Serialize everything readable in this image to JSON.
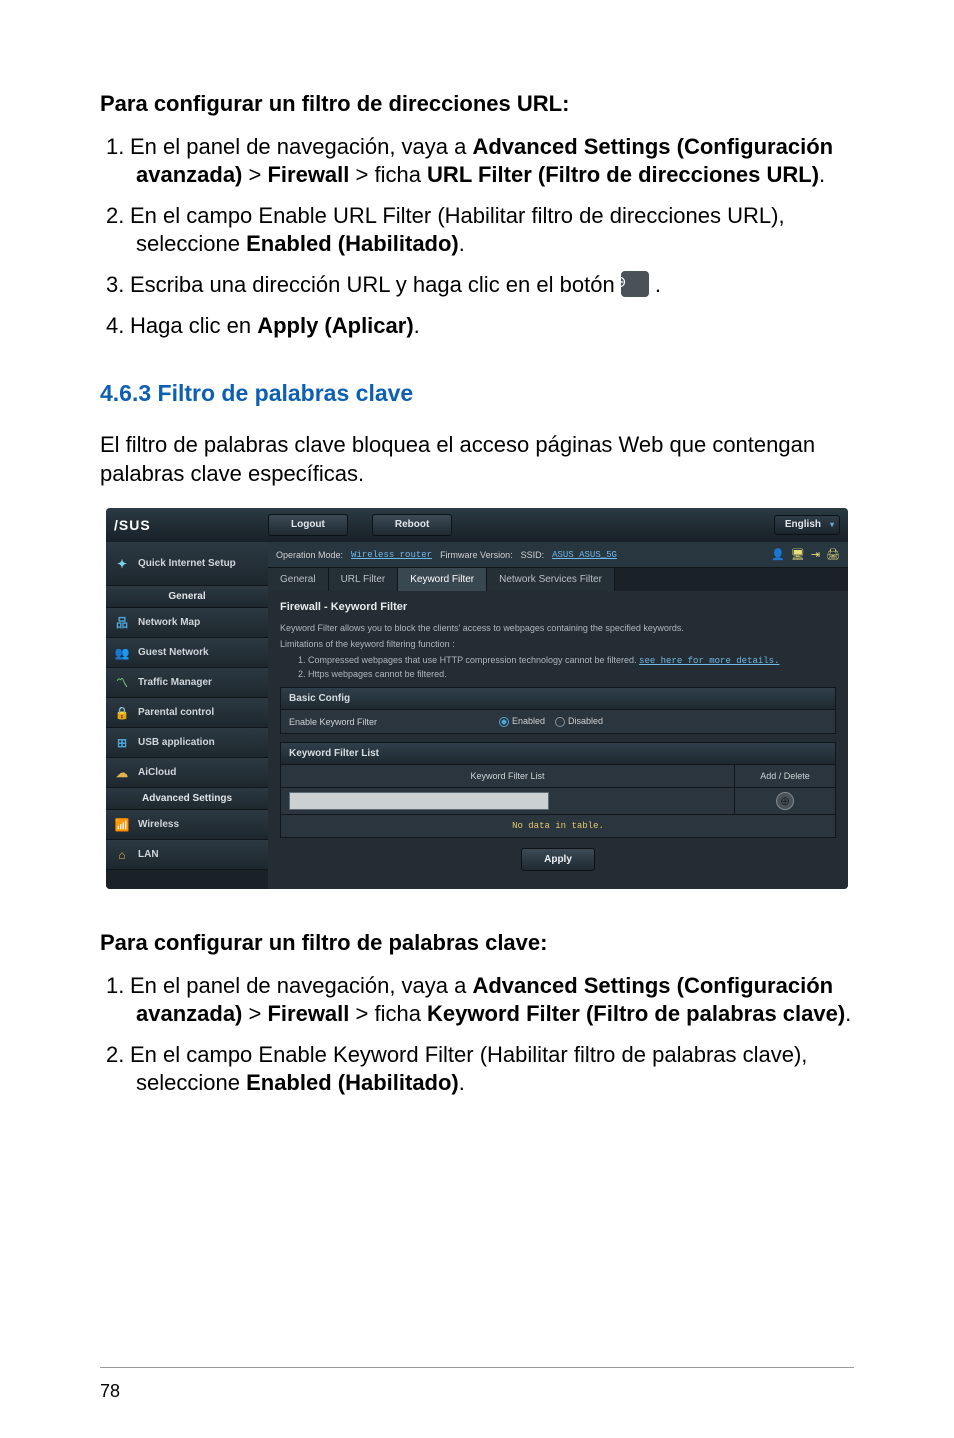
{
  "doc": {
    "section1_heading": "Para configurar un filtro de direcciones URL:",
    "section1_items": [
      "En el panel de navegación, vaya a <b>Advanced Settings (Configuración avanzada)</b> > <b>Firewall</b> > ficha <b>URL Filter (Filtro de direcciones URL)</b>.",
      "En el campo Enable URL Filter (Habilitar filtro de direcciones URL), seleccione <b>Enabled (Habilitado)</b>.",
      "Escriba una dirección URL y haga clic en el botón {ICON} .",
      "Haga clic en <b>Apply (Aplicar)</b>."
    ],
    "subsection_heading": "4.6.3  Filtro de palabras clave",
    "subsection_para": "El filtro de palabras clave bloquea el acceso páginas Web que contengan palabras clave específicas.",
    "section2_heading": "Para configurar un filtro de palabras clave:",
    "section2_items": [
      "En el panel de navegación, vaya a <b>Advanced Settings (Configuración avanzada)</b> > <b>Firewall</b> > ficha <b>Keyword Filter (Filtro de palabras clave)</b>.",
      "En el campo Enable Keyword Filter (Habilitar filtro de palabras clave), seleccione <b>Enabled (Habilitado)</b>."
    ],
    "page_number": "78"
  },
  "router": {
    "logo": "/SUS",
    "logout": "Logout",
    "reboot": "Reboot",
    "language": "English",
    "infobar": {
      "op_mode_label": "Operation Mode:",
      "op_mode_value": "Wireless router",
      "fw_label": "Firmware Version:",
      "ssid_label": "SSID:",
      "ssid_value": "ASUS ASUS_5G"
    },
    "sidebar": {
      "qis": "Quick Internet Setup",
      "general": "General",
      "items_general": [
        "Network Map",
        "Guest Network",
        "Traffic Manager",
        "Parental control",
        "USB application",
        "AiCloud"
      ],
      "advanced": "Advanced Settings",
      "items_advanced": [
        "Wireless",
        "LAN"
      ]
    },
    "tabs": [
      "General",
      "URL Filter",
      "Keyword Filter",
      "Network Services Filter"
    ],
    "panel": {
      "title": "Firewall - Keyword Filter",
      "desc": "Keyword Filter allows you to block the clients' access to webpages containing the specified keywords.",
      "limitations": "Limitations of the keyword filtering function :",
      "li1": "1.  Compressed webpages that use HTTP compression technology cannot be filtered.",
      "li1_link": "see here for more details.",
      "li2": "2.  Https webpages cannot be filtered.",
      "basic_config": "Basic Config",
      "enable_label": "Enable Keyword Filter",
      "enabled": "Enabled",
      "disabled": "Disabled",
      "list_title": "Keyword Filter List",
      "col1": "Keyword Filter List",
      "col2": "Add / Delete",
      "nodata": "No data in table.",
      "apply": "Apply"
    }
  }
}
